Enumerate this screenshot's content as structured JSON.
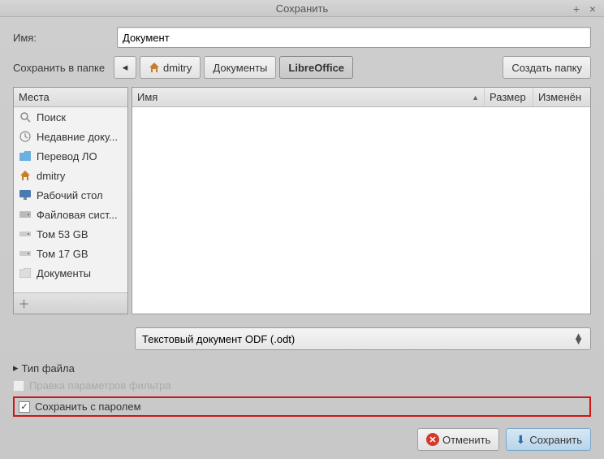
{
  "titlebar": {
    "title": "Сохранить"
  },
  "name": {
    "label": "Имя:",
    "value": "Документ"
  },
  "saveInFolder": {
    "label": "Сохранить в папке",
    "path": [
      "dmitry",
      "Документы",
      "LibreOffice"
    ],
    "createFolder": "Создать папку"
  },
  "places": {
    "header": "Места",
    "items": [
      {
        "label": "Поиск",
        "icon": "search"
      },
      {
        "label": "Недавние доку...",
        "icon": "clock"
      },
      {
        "label": "Перевод ЛО",
        "icon": "folder"
      },
      {
        "label": "dmitry",
        "icon": "home"
      },
      {
        "label": "Рабочий стол",
        "icon": "desktop"
      },
      {
        "label": "Файловая сист...",
        "icon": "disk"
      },
      {
        "label": "Том 53 GB",
        "icon": "drive"
      },
      {
        "label": "Том 17 GB",
        "icon": "drive"
      },
      {
        "label": "Документы",
        "icon": "folder-doc"
      }
    ]
  },
  "fileList": {
    "columns": {
      "name": "Имя",
      "size": "Размер",
      "modified": "Изменён"
    }
  },
  "fileType": {
    "selected": "Текстовый документ ODF (.odt)",
    "disclosure": "Тип файла"
  },
  "options": {
    "filterParams": "Правка параметров фильтра",
    "saveWithPassword": "Сохранить с паролем"
  },
  "buttons": {
    "cancel": "Отменить",
    "save": "Сохранить"
  }
}
